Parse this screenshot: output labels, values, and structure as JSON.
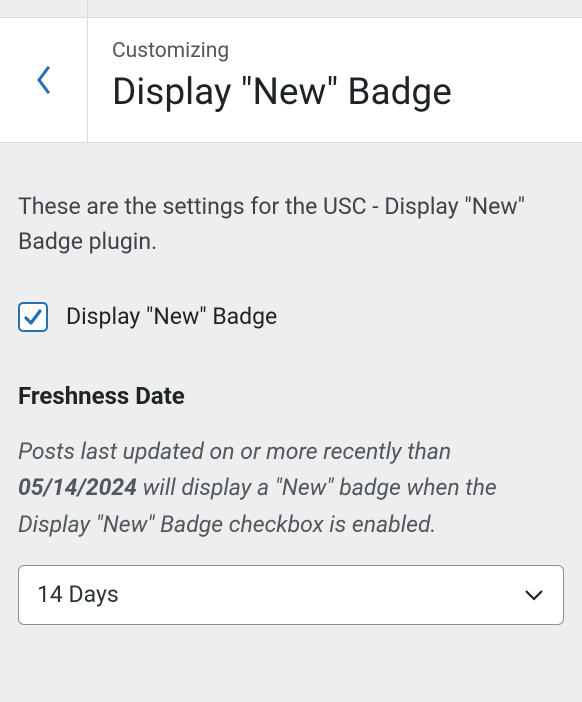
{
  "header": {
    "eyebrow": "Customizing",
    "title": "Display \"New\" Badge"
  },
  "description": "These are the settings for the USC - Display \"New\" Badge plugin.",
  "checkbox": {
    "label": "Display \"New\" Badge",
    "checked": true
  },
  "freshness": {
    "heading": "Freshness Date",
    "sub_pre": "Posts last updated on or more recently than ",
    "date": "05/14/2024",
    "sub_post": " will display a \"New\" badge when the Display \"New\" Badge checkbox is enabled.",
    "selected": "14 Days"
  }
}
